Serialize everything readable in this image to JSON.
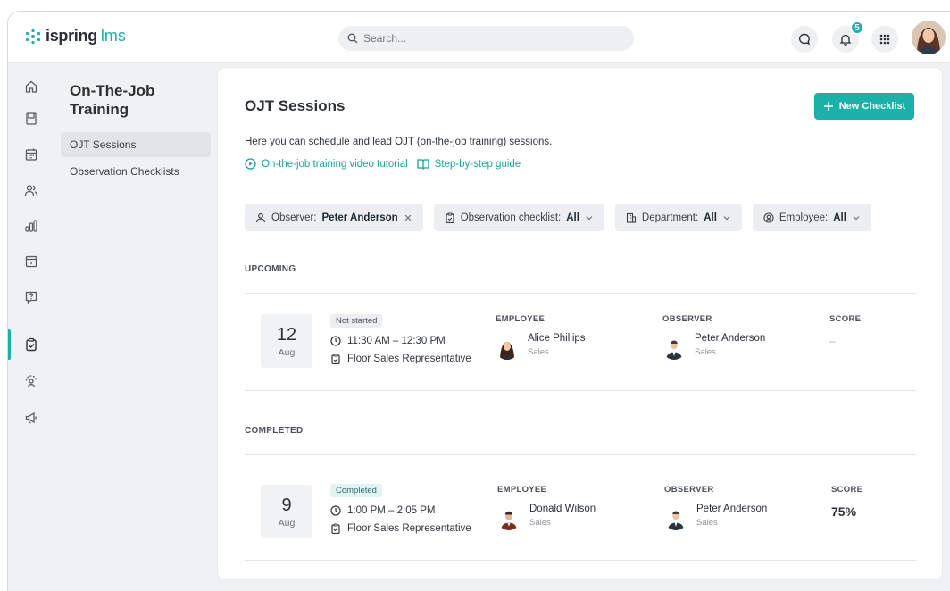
{
  "app": {
    "logo_text": "ispring",
    "logo_suffix": "lms"
  },
  "search": {
    "placeholder": "Search..."
  },
  "header": {
    "notifications_count": "5"
  },
  "subnav": {
    "title": "On-The-Job Training",
    "items": [
      {
        "label": "OJT Sessions"
      },
      {
        "label": "Observation Checklists"
      }
    ]
  },
  "page": {
    "title": "OJT Sessions",
    "description": "Here you can schedule and lead OJT (on-the-job training) sessions.",
    "link_video": "On-the-job training video tutorial",
    "link_guide": "Step-by-step guide",
    "new_button": "New Checklist"
  },
  "filters": {
    "observer_label": "Observer:",
    "observer_value": "Peter Anderson",
    "checklist_label": "Observation checklist:",
    "checklist_value": "All",
    "department_label": "Department:",
    "department_value": "All",
    "employee_label": "Employee:",
    "employee_value": "All"
  },
  "columns": {
    "employee": "EMPLOYEE",
    "observer": "OBSERVER",
    "score": "SCORE"
  },
  "upcoming": {
    "label": "UPCOMING",
    "session": {
      "day": "12",
      "month": "Aug",
      "status": "Not started",
      "time": "11:30 AM – 12:30 PM",
      "checklist": "Floor Sales Representative",
      "employee_name": "Alice Phillips",
      "employee_dept": "Sales",
      "observer_name": "Peter Anderson",
      "observer_dept": "Sales",
      "score": "–"
    }
  },
  "completed": {
    "label": "COMPLETED",
    "session": {
      "day": "9",
      "month": "Aug",
      "status": "Completed",
      "time": "1:00 PM – 2:05 PM",
      "checklist": "Floor Sales Representative",
      "employee_name": "Donald Wilson",
      "employee_dept": "Sales",
      "observer_name": "Peter Anderson",
      "observer_dept": "Sales",
      "score": "75%"
    }
  },
  "colors": {
    "accent": "#1bb0a8"
  }
}
